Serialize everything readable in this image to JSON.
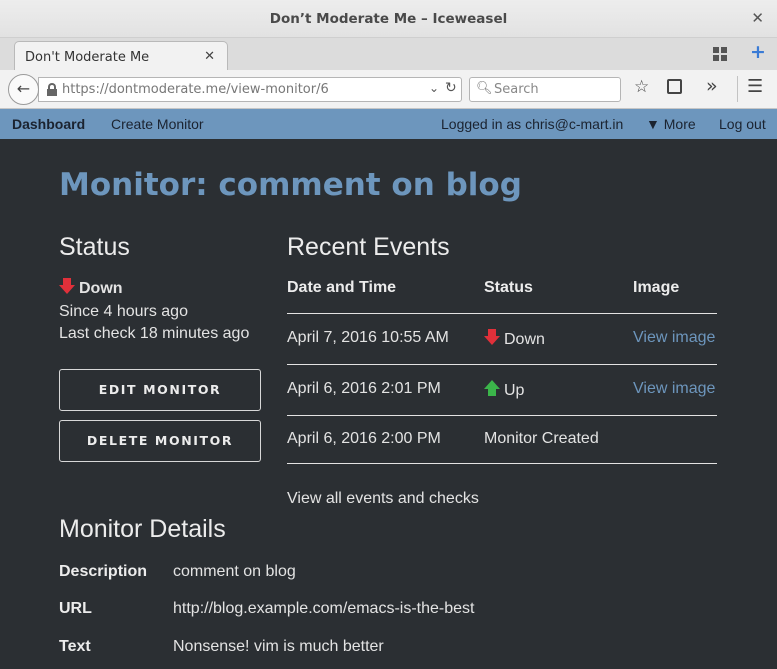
{
  "window": {
    "title": "Don’t Moderate Me – Iceweasel",
    "close_glyph": "✕"
  },
  "tab": {
    "label": "Don't Moderate Me",
    "close_glyph": "✕",
    "new_tab_glyph": "+"
  },
  "nav": {
    "back_glyph": "←",
    "url_host": "https://dontmoderate.me",
    "url_path": "/view-monitor/6",
    "search_placeholder": "Search",
    "icons": [
      "back-icon",
      "lock-icon",
      "dropdown-icon",
      "reload-icon",
      "search-icon",
      "star-icon",
      "reader-icon",
      "overflow-icon",
      "menu-icon"
    ]
  },
  "header": {
    "brand": "Dashboard",
    "create": "Create Monitor",
    "logged_in": "Logged in as chris@c-mart.in",
    "more": "▼ More",
    "logout": "Log out",
    "color": "#6d96bd"
  },
  "page": {
    "title": "Monitor: comment on blog"
  },
  "status": {
    "heading": "Status",
    "state": "Down",
    "since": "Since 4 hours ago",
    "last_check": "Last check 18 minutes ago",
    "edit_button": "EDIT MONITOR",
    "delete_button": "DELETE MONITOR",
    "down_color": "#e0303a",
    "up_color": "#3bb54a"
  },
  "events": {
    "heading": "Recent Events",
    "columns": [
      "Date and Time",
      "Status",
      "Image"
    ],
    "rows": [
      {
        "date": "April 7, 2016 10:55 AM",
        "status": "Down",
        "icon": "down-arrow-icon",
        "image": "View image"
      },
      {
        "date": "April 6, 2016 2:01 PM",
        "status": "Up",
        "icon": "up-arrow-icon",
        "image": "View image"
      },
      {
        "date": "April 6, 2016 2:00 PM",
        "status": "Monitor Created",
        "icon": "",
        "image": ""
      }
    ],
    "view_all": "View all events and checks"
  },
  "details": {
    "heading": "Monitor Details",
    "description_label": "Description",
    "description_value": "comment on blog",
    "url_label": "URL",
    "url_value": "http://blog.example.com/emacs-is-the-best",
    "text_label": "Text",
    "text_value": "Nonsense! vim is much better"
  }
}
